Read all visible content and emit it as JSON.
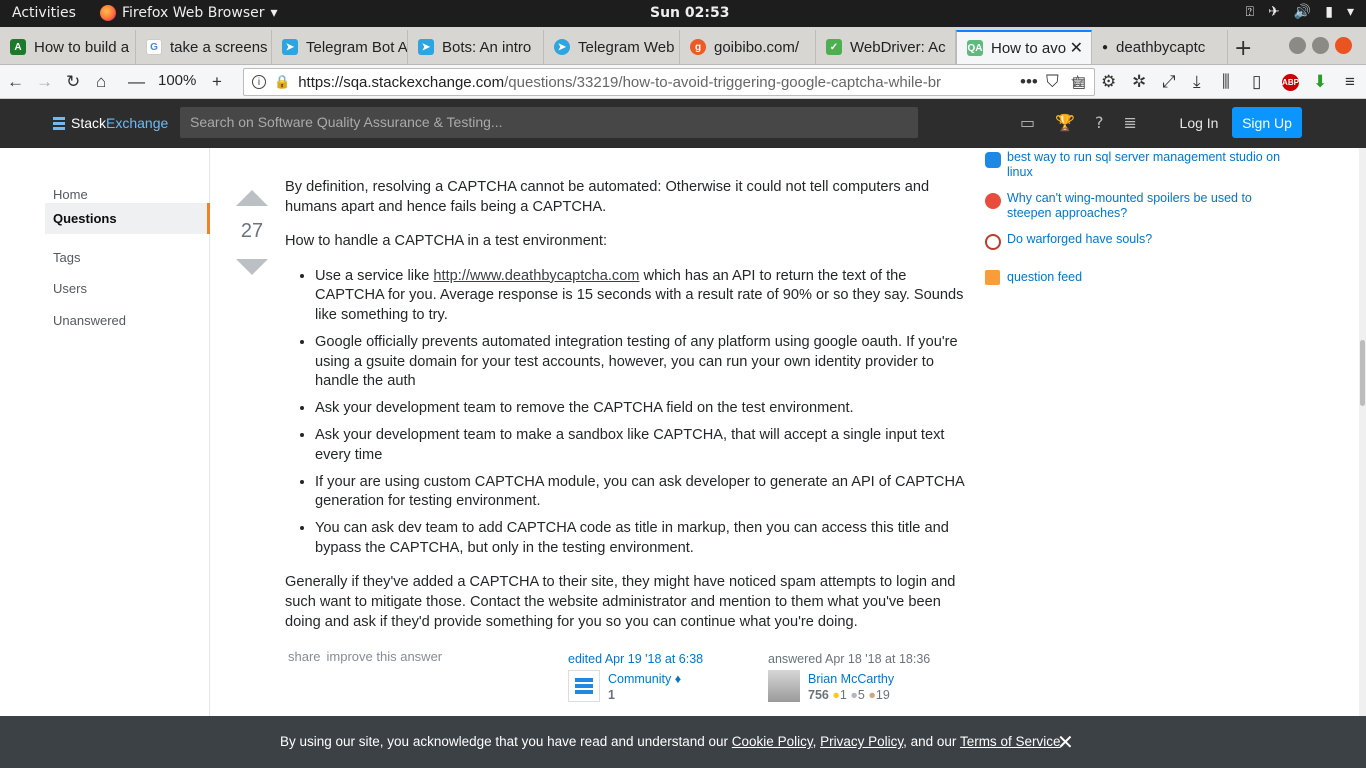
{
  "topbar": {
    "activities": "Activities",
    "app_name": "Firefox Web Browser",
    "clock": "Sun 02:53"
  },
  "tabs": [
    {
      "label": "How to build a",
      "favicon_color": "#1b7a2b",
      "icon": "android-icon"
    },
    {
      "label": "take a screens",
      "favicon_color": "#ffffff",
      "icon": "google-icon"
    },
    {
      "label": "Telegram Bot A",
      "favicon_color": "#2ca5e0",
      "icon": "telegram-icon"
    },
    {
      "label": "Bots: An intro",
      "favicon_color": "#2ca5e0",
      "icon": "telegram-icon"
    },
    {
      "label": "Telegram Web",
      "favicon_color": "#2ca5e0",
      "icon": "telegram-icon"
    },
    {
      "label": "goibibo.com/",
      "favicon_color": "#ec5b24",
      "icon": "goibibo-icon"
    },
    {
      "label": "WebDriver: Ac",
      "favicon_color": "#4caf50",
      "icon": "checkbox-icon"
    },
    {
      "label": "How to avo",
      "favicon_color": "#5eba7d",
      "icon": "stackexchange-icon",
      "active": true
    },
    {
      "label": "deathbycaptc",
      "favicon_color": "#666666",
      "icon": "dot-icon"
    }
  ],
  "navbar": {
    "zoom": "100%",
    "url_host": "https://sqa.stackexchange.com",
    "url_path": "/questions/33219/how-to-avoid-triggering-google-captcha-while-br"
  },
  "se_header": {
    "logo_stack": "Stack",
    "logo_exchange": "Exchange",
    "search_placeholder": "Search on Software Quality Assurance & Testing...",
    "login": "Log In",
    "signup": "Sign Up"
  },
  "leftnav": {
    "items": [
      "Home",
      "Questions",
      "Tags",
      "Users",
      "Unanswered"
    ]
  },
  "answer": {
    "votes": "27",
    "p1": "By definition, resolving a CAPTCHA cannot be automated: Otherwise it could not tell computers and humans apart and hence fails being a CAPTCHA.",
    "p2": "How to handle a CAPTCHA in a test environment:",
    "li1_pre": "Use a service like ",
    "li1_link": "http://www.deathbycaptcha.com",
    "li1_post": " which has an API to return the text of the CAPTCHA for you. Average response is 15 seconds with a result rate of 90% or so they say. Sounds like something to try.",
    "li2": "Google officially prevents automated integration testing of any platform using google oauth. If you're using a gsuite domain for your test accounts, however, you can run your own identity provider to handle the auth",
    "li3": "Ask your development team to remove the CAPTCHA field on the test environment.",
    "li4": "Ask your development team to make a sandbox like CAPTCHA, that will accept a single input text every time",
    "li5": "If your are using custom CAPTCHA module, you can ask developer to generate an API of CAPTCHA generation for testing environment.",
    "li6": "You can ask dev team to add CAPTCHA code as title in markup, then you can access this title and bypass the CAPTCHA, but only in the testing environment.",
    "p3": "Generally if they've added a CAPTCHA to their site, they might have noticed spam attempts to login and such want to mitigate those. Contact the website administrator and mention to them what you've been doing and ask if they'd provide something for you so you can continue what you're doing.",
    "share": "share",
    "improve": "improve this answer",
    "edited": "edited Apr 19 '18 at 6:38",
    "editor_name": "Community",
    "editor_diamond": "♦",
    "editor_rep": "1",
    "answered": "answered Apr 18 '18 at 18:36",
    "author_name": "Brian McCarthy",
    "author_rep": "756",
    "gold": "1",
    "silver": "5",
    "bronze": "19"
  },
  "sidebar": {
    "hot": [
      {
        "title": "best way to run sql server management studio on linux",
        "icon_color": "#1e88e5"
      },
      {
        "title": "Why can't wing-mounted spoilers be used to steepen approaches?",
        "icon_color": "#e74c3c"
      },
      {
        "title": "Do warforged have souls?",
        "icon_color": "#c0392b"
      }
    ],
    "feed": "question feed"
  },
  "cookie": {
    "pre": "By using our site, you acknowledge that you have read and understand our ",
    "cookie_policy": "Cookie Policy",
    "comma": ", ",
    "privacy_policy": "Privacy Policy",
    "and": ", and our ",
    "terms": "Terms of Service",
    "end": "."
  }
}
